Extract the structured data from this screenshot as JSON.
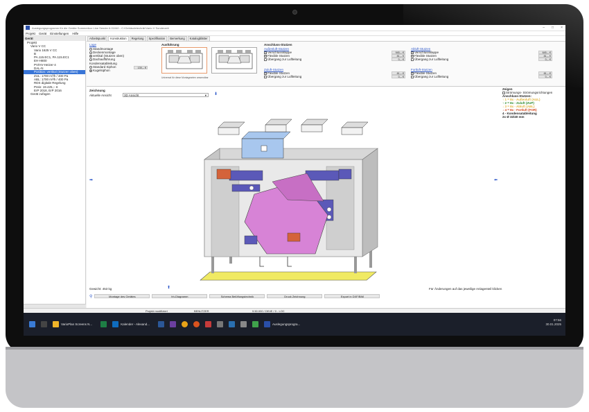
{
  "window": {
    "title": "Auslegungsprogramm für die Geräte Sommerbox Line Sender 6.01040 - C:\\Gebäudetechnik\\Vario V Sonderzeit"
  },
  "menu": [
    "Projekt",
    "Gerät",
    "Einstellungen",
    "Hilfe"
  ],
  "tree": {
    "header": "Gerät",
    "items": [
      {
        "label": "Projekt",
        "indent": 1,
        "selected": false
      },
      {
        "label": "Vario V CC",
        "indent": 2,
        "selected": false
      },
      {
        "label": "Vario 1625 V CC",
        "indent": 3,
        "selected": false
      },
      {
        "label": "B",
        "indent": 3,
        "selected": false
      },
      {
        "label": "PA.115.EC1, PA.115.EC1",
        "indent": 3,
        "selected": false
      },
      {
        "label": "EH-H800",
        "indent": 3,
        "selected": false
      },
      {
        "label": "PV/HV-Heizer-4",
        "indent": 3,
        "selected": false
      },
      {
        "label": "DAL-N",
        "indent": 3,
        "selected": false
      },
      {
        "label": "Position: vertikal (Stutzen oben)",
        "indent": 3,
        "selected": true
      },
      {
        "label": "ZUL: 1700 m³/h / 400 Pa",
        "indent": 3,
        "selected": false
      },
      {
        "label": "ABL: 1700 m³/h / 400 Pa",
        "indent": 3,
        "selected": false
      },
      {
        "label": "RDS digitale Regelung",
        "indent": 3,
        "selected": false
      },
      {
        "label": "Preis: 19.425,-- €",
        "indent": 3,
        "selected": false
      },
      {
        "label": "ErP 2018, ErP 2016",
        "indent": 3,
        "selected": false
      },
      {
        "label": "Gerät zufügen",
        "indent": 2,
        "selected": false
      }
    ]
  },
  "tabs": [
    "Arbeitspunkt",
    "Konstruktion",
    "Regelung",
    "Spezifikation",
    "Bemerkung",
    "Katalogblätter"
  ],
  "active_tab": 1,
  "lage": {
    "heading": "Lage",
    "options": [
      "Standmontage",
      "Deckenmontage",
      "vertikal (Stutzen oben)",
      "Dachaufführung"
    ],
    "selected": 2
  },
  "kondensat": {
    "heading": "Kondensatableitung",
    "options": [
      "Standard Siphon",
      "Kugelsiphon"
    ],
    "selected": 1,
    "price": "139,-- €"
  },
  "ausfuehrung": {
    "heading": "Ausführung",
    "note": "Universal für diese Montagearten anwendbar"
  },
  "stutzen": {
    "heading": "Anschluss-Stutzen",
    "groups": [
      {
        "title": "Außenluft-Stutzen",
        "items": [
          {
            "label": "Verschlussklappe",
            "checked": true,
            "price": "945,-- €"
          },
          {
            "label": "Flexible Stutzen",
            "checked": true,
            "price": "81,-- €"
          },
          {
            "label": "Übergang zur Luftleitung",
            "checked": false,
            "price": "0,-- €"
          }
        ]
      },
      {
        "title": "Abluft-Stutzen",
        "items": [
          {
            "label": "Verschlussklappe",
            "checked": true,
            "price": "645,-- €"
          },
          {
            "label": "Flexible Stutzen",
            "checked": true,
            "price": "81,-- €"
          },
          {
            "label": "Übergang zur Luftleitung",
            "checked": false,
            "price": "0,-- €"
          }
        ]
      },
      {
        "title": "Zuluft-Stutzen",
        "items": [
          {
            "label": "Flexible Stutzen",
            "checked": true,
            "price": "81,-- €"
          },
          {
            "label": "Übergang zur Luftleitung",
            "checked": false,
            "price": "0,-- €"
          }
        ]
      },
      {
        "title": "Fortluft-Stutzen",
        "items": [
          {
            "label": "Flexible Stutzen",
            "checked": true,
            "price": "81,-- €"
          },
          {
            "label": "Übergang zur Luftleitung",
            "checked": false,
            "price": "0,-- €"
          }
        ]
      }
    ]
  },
  "zeichnung": {
    "heading": "Zeichnung",
    "view_label": "Aktuelle Ansicht",
    "view_value": "3D Ansicht",
    "weight": "Gewicht: 453 kg",
    "hint": "Für Änderungen auf das jeweilige Anlagenteil klicken"
  },
  "zeigen": {
    "heading": "Zeigen",
    "checkbox": "Strömungs- Strömungsrichtungen",
    "subheading": "Anschluss-Stutzen:",
    "lines": [
      {
        "text": "↑ 1 = 8x - Außenluft (AUL)",
        "color": "#e0b23a"
      },
      {
        "text": "↑ 2 = 8x - Zuluft (ZUP)",
        "color": "#2c8a2c"
      },
      {
        "text": "↓ 3 = 8x - Abluft (ABL)",
        "color": "#e0b23a"
      },
      {
        "text": "↓ 4 = 8x - Fortluft (FOR)",
        "color": "#d0441a"
      },
      {
        "text": "4 - Kondensatableitung",
        "color": "#222222"
      },
      {
        "text": "2x Ø 32/40 mm",
        "color": "#222222"
      }
    ]
  },
  "buttons": [
    "Montage des Gerätes",
    "hh-Diagramm",
    "Schema Belüftungstechnik",
    "Druck Zeichnung",
    "Export in DXF/BIM"
  ],
  "status": {
    "modified": "Projekt modifiziert",
    "user": "BENUTZER",
    "scale": "9.50.000 / DE4E / 0 - LOC"
  },
  "taskbar": {
    "apps": [
      "VarioPlan Screens N...",
      "Kalender - Alexand...",
      "Auslegungsprogra..."
    ],
    "time": "07:56",
    "date": "30.01.2025"
  },
  "colors": {
    "housing": "#c9c9c9",
    "exchanger": "#d783d6",
    "duct": "#5b59b8",
    "top_filter": "#a8c7ee",
    "accent_red": "#d4633a",
    "base_yellow": "#f0ea63"
  }
}
